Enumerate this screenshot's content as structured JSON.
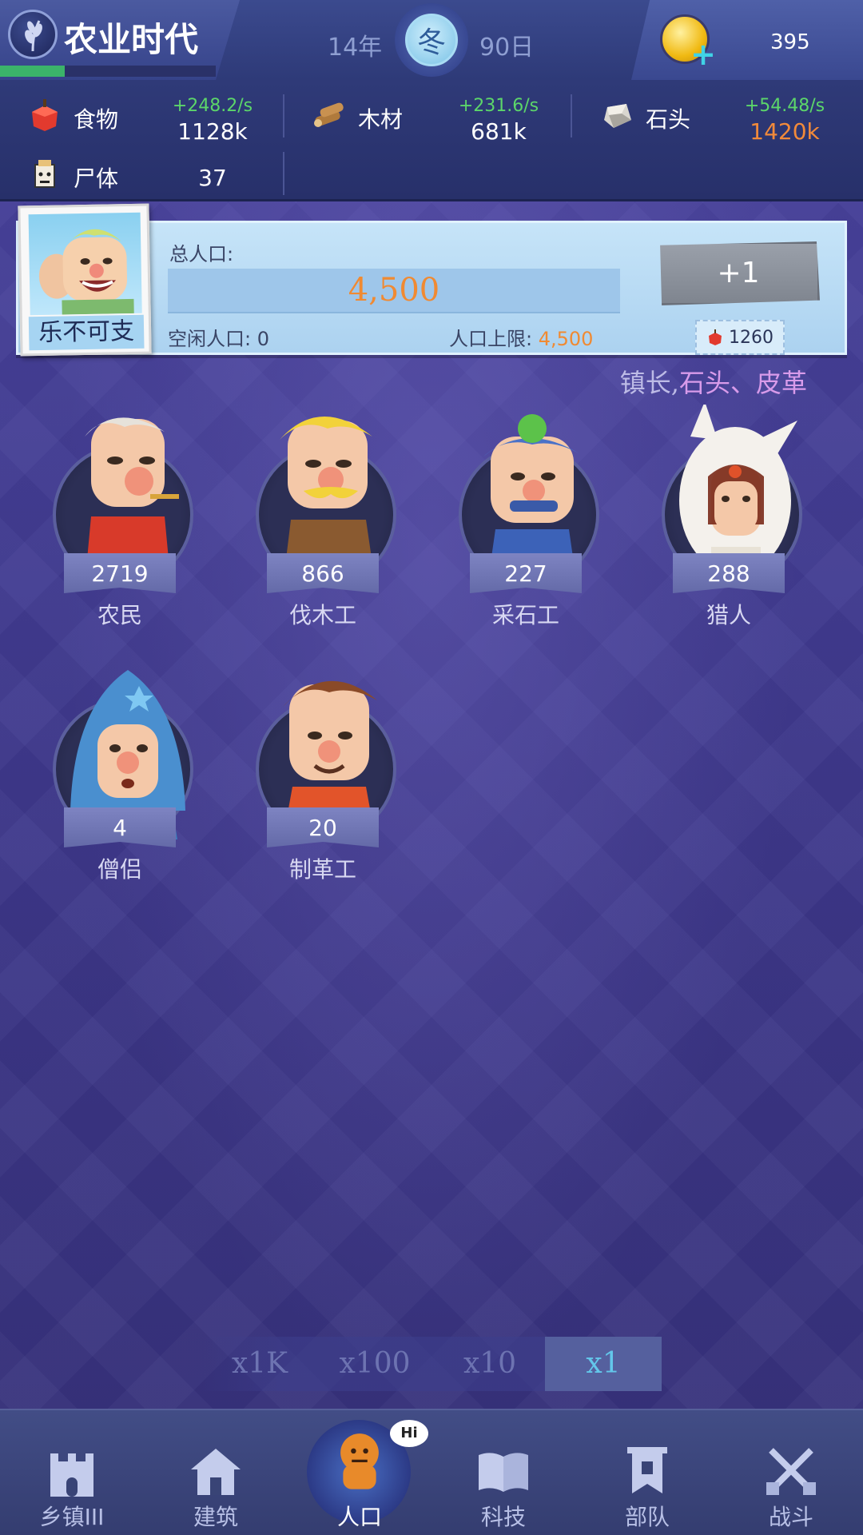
{
  "header": {
    "era": "农业时代",
    "year": "14年",
    "season": "冬",
    "day": "90日",
    "coins": "395",
    "era_progress": 0.3
  },
  "resources": [
    {
      "icon": "food-apple-icon",
      "name": "食物",
      "rate": "+248.2/s",
      "amount": "1128k"
    },
    {
      "icon": "wood-logs-icon",
      "name": "木材",
      "rate": "+231.6/s",
      "amount": "681k"
    },
    {
      "icon": "stone-block-icon",
      "name": "石头",
      "rate": "+54.48/s",
      "amount": "1420k"
    },
    {
      "icon": "corpse-icon",
      "name": "尸体",
      "rate": "",
      "amount": "37"
    }
  ],
  "population": {
    "leader_name": "乐不可支",
    "total_label": "总人口:",
    "total": "4,500",
    "idle_label": "空闲人口: 0",
    "limit_label": "人口上限:",
    "limit": "4,500",
    "add_button": "+1",
    "cost": "1260"
  },
  "hint": {
    "prefix": "镇长,",
    "highlight": "石头、皮革"
  },
  "workers": [
    {
      "name": "农民",
      "count": "2719"
    },
    {
      "name": "伐木工",
      "count": "866"
    },
    {
      "name": "采石工",
      "count": "227"
    },
    {
      "name": "猎人",
      "count": "288"
    },
    {
      "name": "僧侣",
      "count": "4"
    },
    {
      "name": "制革工",
      "count": "20"
    }
  ],
  "multipliers": [
    "x1K",
    "x100",
    "x10",
    "x1"
  ],
  "multiplier_selected": "x1",
  "nav": [
    {
      "icon": "castle-icon",
      "label": "乡镇III"
    },
    {
      "icon": "house-icon",
      "label": "建筑"
    },
    {
      "icon": "person-icon",
      "label": "人口",
      "badge": "Hi"
    },
    {
      "icon": "book-icon",
      "label": "科技"
    },
    {
      "icon": "banner-icon",
      "label": "部队"
    },
    {
      "icon": "crossed-swords-icon",
      "label": "战斗"
    }
  ],
  "colors": {
    "rate_green": "#5cd66a",
    "warn_orange": "#f28a3a",
    "accent_cyan": "#63c7ea"
  }
}
